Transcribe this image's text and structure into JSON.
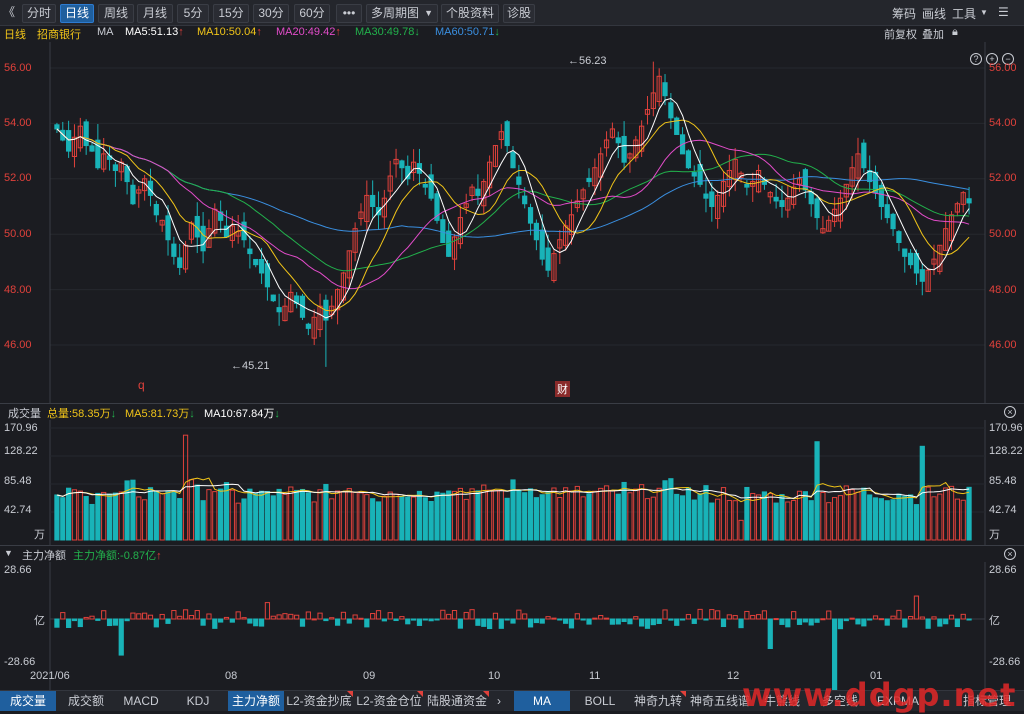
{
  "toolbar": {
    "back": "《",
    "periods": [
      "分时",
      "日线",
      "周线",
      "月线",
      "5分",
      "15分",
      "30分",
      "60分",
      "•••",
      "多周期图",
      "个股资料",
      "诊股"
    ],
    "right": [
      "筹码",
      "画线",
      "工具"
    ]
  },
  "info": {
    "period": "日线",
    "stock": "招商银行",
    "indicator": "MA",
    "ma5": "MA5:51.13",
    "ma10": "MA10:50.04",
    "ma20": "MA20:49.42",
    "ma30": "MA30:49.78",
    "ma60": "MA60:50.71",
    "adjust": "前复权",
    "overlay": "叠加"
  },
  "price_axis": [
    "56.00",
    "54.00",
    "52.00",
    "50.00",
    "48.00",
    "46.00"
  ],
  "annotations": {
    "high": "56.23",
    "low": "45.21",
    "event_q": "q",
    "event_cai": "财"
  },
  "volume": {
    "title": "成交量",
    "total": "总量:58.35万",
    "ma5": "MA5:81.73万",
    "ma10": "MA10:67.84万",
    "axis": [
      "170.96",
      "128.22",
      "85.48",
      "42.74",
      "万"
    ]
  },
  "flow": {
    "title": "主力净额",
    "value": "主力净额:-0.87亿",
    "axis": [
      "28.66",
      "亿",
      "-28.66"
    ]
  },
  "dates": [
    "2021/06",
    "08",
    "09",
    "10",
    "11",
    "12",
    "01"
  ],
  "bottom_tabs": [
    "成交量",
    "成交额",
    "MACD",
    "KDJ",
    "主力净额",
    "L2-资金抄底",
    "L2-资金仓位",
    "陆股通资金",
    "MA",
    "BOLL",
    "神奇九转",
    "神奇五线谱",
    "牛熊线",
    "多空线",
    "EXPMA",
    "指标管理"
  ],
  "watermark": "www.ddgp.net",
  "colors": {
    "up": "#e0413b",
    "down": "#19b3b8",
    "ma5": "#ffffff",
    "ma10": "#f0c419",
    "ma20": "#e24cc9",
    "ma30": "#22b14c",
    "ma60": "#3a8fe0",
    "active": "#1f5f9e"
  },
  "chart_data": {
    "type": "candlestick",
    "sessions": 155,
    "price_range": [
      44.6,
      57.2
    ],
    "high": 56.23,
    "low": 45.21,
    "close": [
      53.8,
      53.4,
      53.0,
      53.5,
      53.9,
      53.2,
      53.0,
      52.4,
      52.9,
      52.7,
      52.3,
      52.6,
      51.9,
      51.1,
      51.6,
      52.0,
      51.4,
      50.7,
      50.5,
      49.8,
      49.2,
      48.8,
      49.6,
      50.4,
      49.9,
      49.4,
      50.2,
      50.9,
      50.5,
      49.9,
      50.3,
      50.1,
      49.8,
      49.3,
      48.9,
      48.6,
      48.1,
      47.6,
      47.2,
      47.4,
      47.9,
      47.5,
      47.0,
      46.6,
      47.0,
      47.4,
      46.9,
      47.4,
      48.0,
      48.6,
      49.4,
      50.2,
      50.8,
      51.4,
      51.0,
      50.7,
      51.3,
      52.1,
      52.7,
      52.4,
      52.0,
      52.6,
      52.2,
      51.7,
      51.3,
      50.5,
      49.7,
      49.2,
      49.9,
      50.6,
      51.1,
      51.7,
      51.4,
      51.9,
      52.6,
      53.2,
      53.7,
      53.2,
      52.4,
      51.8,
      51.1,
      50.4,
      49.8,
      49.1,
      48.7,
      49.3,
      49.8,
      50.3,
      50.7,
      51.2,
      51.6,
      51.9,
      52.4,
      52.9,
      53.4,
      53.8,
      53.3,
      52.6,
      52.9,
      53.4,
      53.9,
      54.5,
      55.1,
      55.7,
      55.0,
      54.2,
      53.6,
      52.9,
      52.4,
      52.1,
      51.8,
      51.3,
      51.0,
      51.4,
      51.9,
      52.3,
      52.7,
      52.2,
      51.7,
      51.9,
      52.3,
      51.8,
      51.5,
      51.2,
      51.0,
      51.3,
      51.7,
      52.0,
      51.6,
      51.1,
      50.6,
      50.2,
      50.5,
      50.9,
      51.3,
      51.8,
      52.4,
      52.9,
      52.4,
      51.9,
      51.5,
      51.0,
      50.6,
      50.2,
      49.7,
      49.2,
      48.9,
      48.6,
      48.3,
      48.7,
      49.1,
      49.6,
      50.2,
      50.7,
      51.1,
      51.5,
      51.13
    ],
    "volume_axis_max": 170.96,
    "volume_unit": "万",
    "flow_axis_max": 28.66,
    "flow_unit": "亿",
    "x_ticks": [
      "2021/06",
      "08",
      "09",
      "10",
      "11",
      "12",
      "01"
    ]
  }
}
